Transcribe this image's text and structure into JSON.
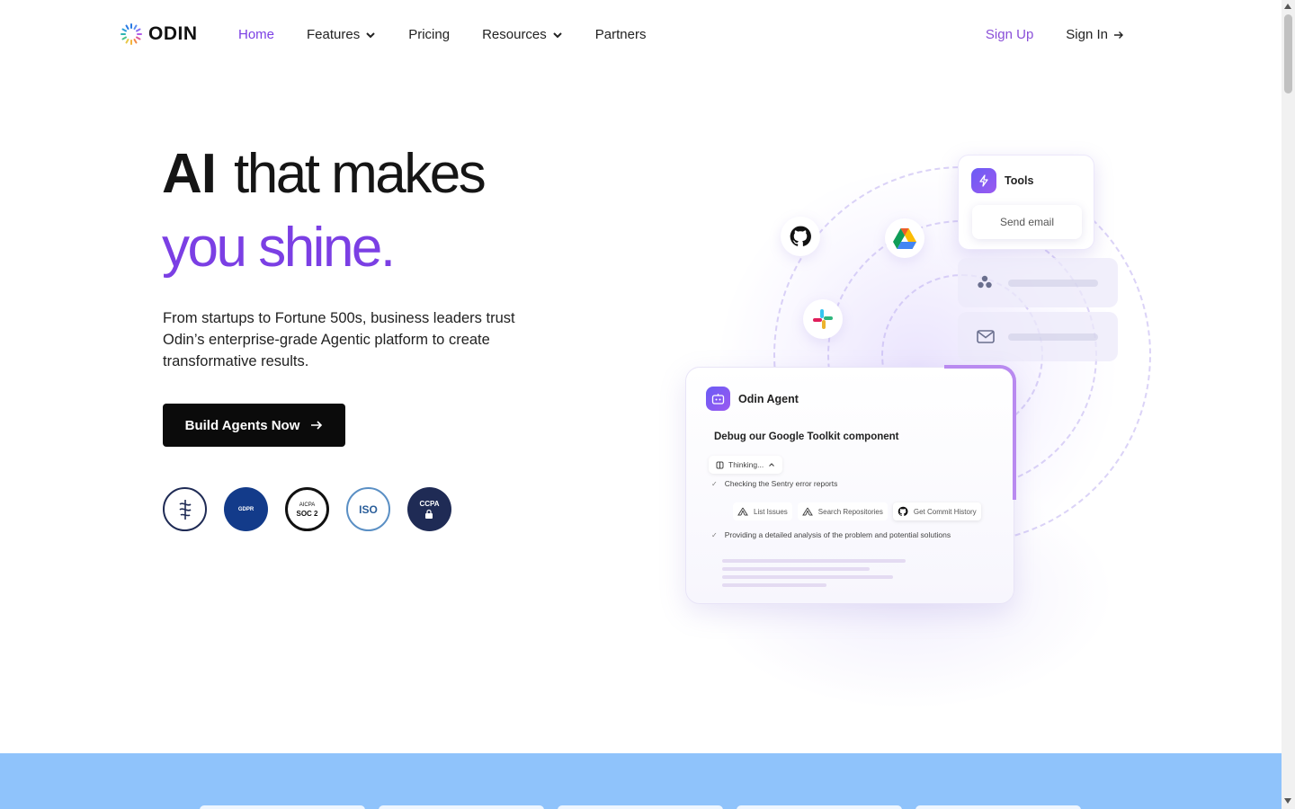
{
  "brand": {
    "name": "ODIN"
  },
  "nav": {
    "links": [
      {
        "label": "Home",
        "active": true
      },
      {
        "label": "Features",
        "dropdown": true
      },
      {
        "label": "Pricing"
      },
      {
        "label": "Resources",
        "dropdown": true
      },
      {
        "label": "Partners"
      }
    ],
    "signup": "Sign Up",
    "signin": "Sign In"
  },
  "hero": {
    "title_bold": "AI",
    "title_rest": "that makes",
    "title_line2": "you shine.",
    "subtitle": "From startups to Fortune 500s, business leaders trust Odin’s enterprise-grade Agentic platform to create transformative results.",
    "cta": "Build Agents Now",
    "badges": [
      "HIPAA",
      "GDPR",
      "SOC 2",
      "ISO",
      "CCPA"
    ],
    "badge_texts": {
      "aicpa": "AICPA",
      "soc": "SOC 2",
      "gdpr": "GDPR",
      "iso": "ISO",
      "ccpa": "CCPA"
    }
  },
  "illustration": {
    "tools_label": "Tools",
    "send_email": "Send email",
    "agent_name": "Odin Agent",
    "task": "Debug our Google Toolkit component",
    "thinking": "Thinking...",
    "step1": "Checking the Sentry error reports",
    "chips": [
      "List Issues",
      "Search Repositories",
      "Get Commit History"
    ],
    "step2": "Providing a detailed analysis of the problem and potential solutions"
  },
  "colors": {
    "accent": "#7b3fe4",
    "cta_bg": "#0b0b0b",
    "band": "#8fc3fb"
  }
}
